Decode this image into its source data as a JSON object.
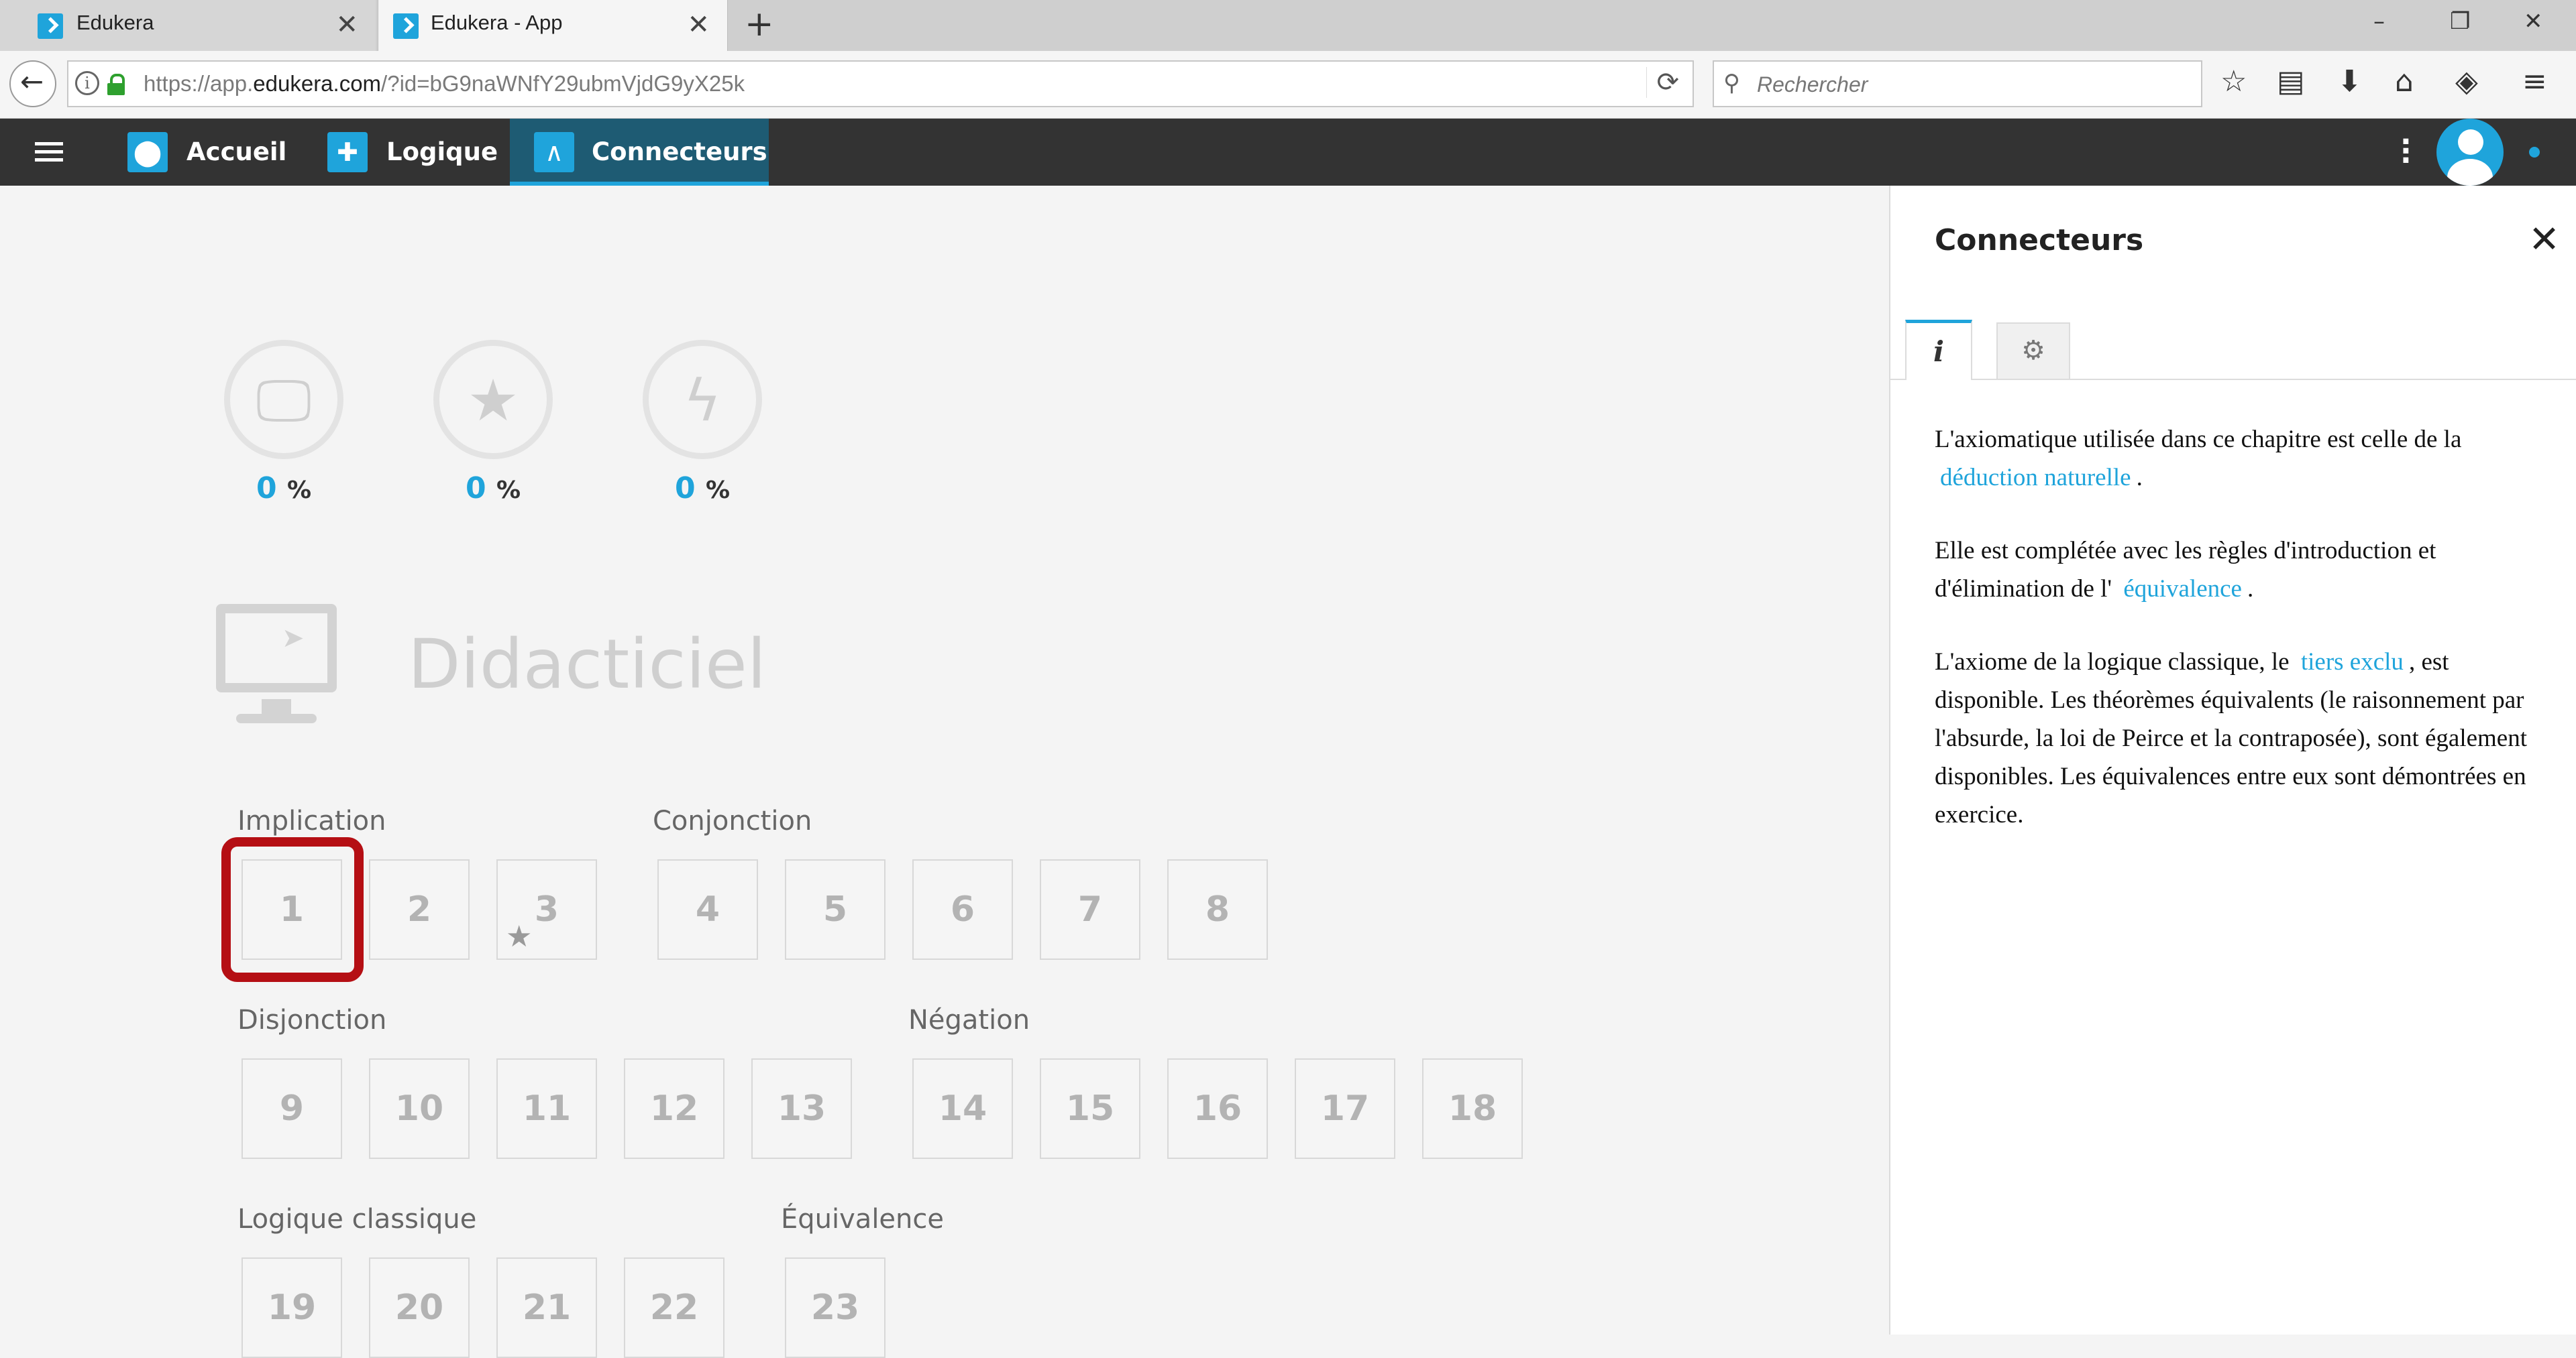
{
  "browser": {
    "tabs": [
      {
        "title": "Edukera",
        "active": false
      },
      {
        "title": "Edukera - App",
        "active": true
      }
    ],
    "url_prefix": "https://app.",
    "url_domain": "edukera.com",
    "url_path": "/?id=bG9naWNfY29ubmVjdG9yX25k",
    "search_placeholder": "Rechercher"
  },
  "header": {
    "nav": [
      {
        "label": "Accueil",
        "icon": "map-marker-icon"
      },
      {
        "label": "Logique",
        "icon": "puzzle-icon"
      },
      {
        "label": "Connecteurs",
        "icon": "lambda-icon",
        "active": true
      }
    ],
    "accent": "#1fa4db"
  },
  "stats": [
    {
      "icon": "monitor-icon",
      "value": "0",
      "unit": "%"
    },
    {
      "icon": "star-icon",
      "value": "0",
      "unit": "%"
    },
    {
      "icon": "lightning-icon",
      "value": "0",
      "unit": "%"
    }
  ],
  "section": {
    "title": "Didacticiel",
    "groups": [
      {
        "label": "Implication",
        "items": [
          "1",
          "2",
          "3"
        ]
      },
      {
        "label": "Conjonction",
        "items": [
          "4",
          "5",
          "6",
          "7",
          "8"
        ]
      },
      {
        "label": "Disjonction",
        "items": [
          "9",
          "10",
          "11",
          "12",
          "13"
        ]
      },
      {
        "label": "Négation",
        "items": [
          "14",
          "15",
          "16",
          "17",
          "18"
        ]
      },
      {
        "label": "Logique classique",
        "items": [
          "19",
          "20",
          "21",
          "22"
        ]
      },
      {
        "label": "Équivalence",
        "items": [
          "23"
        ]
      }
    ],
    "highlighted_item": "1",
    "starred_item": "3"
  },
  "panel": {
    "title": "Connecteurs",
    "tabs": [
      "i",
      "settings"
    ],
    "p1_text": "L'axiomatique utilisée dans ce chapitre est celle de la",
    "p1_link": "déduction naturelle",
    "p1_end": ".",
    "p2_text": "Elle est complétée avec les règles d'introduction et d'élimination de l'",
    "p2_link": "équivalence",
    "p2_end": ".",
    "p3_text": "L'axiome de la logique classique, le",
    "p3_link": "tiers exclu",
    "p3_end": ", est disponible. Les théorèmes équivalents (le raisonnement par l'absurde, la loi de Peirce et la contraposée), sont également disponibles. Les équivalences entre eux sont démontrées en exercice."
  }
}
